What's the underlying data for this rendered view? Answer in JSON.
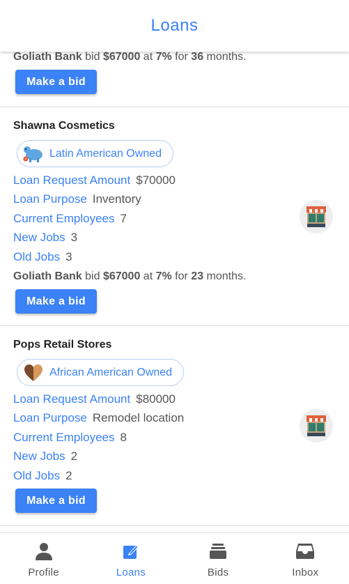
{
  "header": {
    "title": "Loans"
  },
  "field_labels": {
    "amount": "Loan Request Amount",
    "purpose": "Loan Purpose",
    "employees": "Current Employees",
    "new_jobs": "New Jobs",
    "old_jobs": "Old Jobs"
  },
  "bid_words": {
    "bid": "bid",
    "at": "at",
    "for": "for",
    "months": "months."
  },
  "make_bid_label": "Make a bid",
  "partial_card": {
    "bid": {
      "bank": "Goliath Bank",
      "amount": "$67000",
      "rate": "7%",
      "term": "36"
    }
  },
  "cards": [
    {
      "name": "Shawna Cosmetics",
      "badge": "Latin American Owned",
      "badge_icon": "piggy-bank-icon",
      "amount": "$70000",
      "purpose": "Inventory",
      "employees": "7",
      "new_jobs": "3",
      "old_jobs": "3",
      "bid": {
        "bank": "Goliath Bank",
        "amount": "$67000",
        "rate": "7%",
        "term": "23"
      }
    },
    {
      "name": "Pops Retail Stores",
      "badge": "African American Owned",
      "badge_icon": "heart-icon",
      "amount": "$80000",
      "purpose": "Remodel location",
      "employees": "8",
      "new_jobs": "2",
      "old_jobs": "2"
    }
  ],
  "nav": [
    {
      "label": "Profile",
      "icon": "person-icon",
      "active": false
    },
    {
      "label": "Loans",
      "icon": "edit-icon",
      "active": true
    },
    {
      "label": "Bids",
      "icon": "stack-icon",
      "active": false
    },
    {
      "label": "Inbox",
      "icon": "inbox-icon",
      "active": false
    }
  ],
  "colors": {
    "accent": "#3b82f6",
    "text": "#555555",
    "divider": "#dcdcdc"
  }
}
